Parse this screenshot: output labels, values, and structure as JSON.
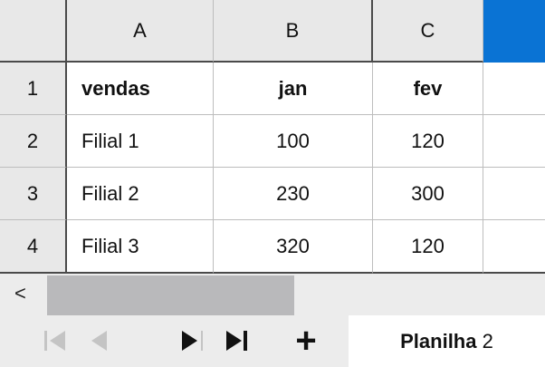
{
  "columns": [
    "A",
    "B",
    "C"
  ],
  "rows": [
    {
      "num": "1",
      "a": "vendas",
      "b": "jan",
      "c": "fev"
    },
    {
      "num": "2",
      "a": "Filial 1",
      "b": "100",
      "c": "120"
    },
    {
      "num": "3",
      "a": "Filial 2",
      "b": "230",
      "c": "300"
    },
    {
      "num": "4",
      "a": "Filial 3",
      "b": "320",
      "c": "120"
    }
  ],
  "scroll": {
    "left_arrow": "<"
  },
  "tabs": {
    "sheet_name_bold": "Planilha",
    "sheet_number": "2",
    "add_label": "+"
  },
  "colors": {
    "selected_header": "#0a73d4",
    "header_bg": "#e8e8e8",
    "scroll_thumb": "#b9b9bb"
  }
}
